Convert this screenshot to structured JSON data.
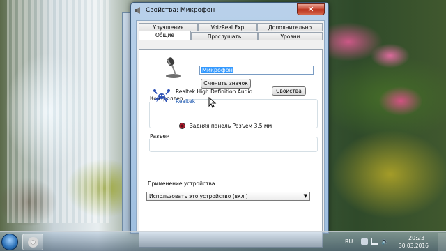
{
  "window": {
    "title": "Свойства: Микрофон",
    "close_glyph": "✕"
  },
  "tabs": {
    "row_back": [
      "Улучшения",
      "VoizReal Exp",
      "Дополнительно"
    ],
    "row_front": [
      "Общие",
      "Прослушать",
      "Уровни"
    ],
    "active": "Общие"
  },
  "general": {
    "device_name": "Микрофон",
    "change_icon_button": "Сменить значок",
    "controller_group": "Контроллер",
    "controller_name": "Realtek High Definition Audio",
    "controller_vendor": "Realtek",
    "properties_button": "Свойства",
    "jack_group": "Разъем",
    "jack_text": "Задняя панель Разъем 3,5 мм",
    "usage_label": "Применение устройства:",
    "usage_value": "Использовать это устройство (вкл.)"
  },
  "taskbar": {
    "language": "RU",
    "time": "20:23",
    "date": "30.03.2016"
  },
  "icons": [
    "microphone-icon",
    "realtek-crab-icon",
    "red-jack-icon",
    "windows-start-icon",
    "media-player-icon",
    "network-icon",
    "volume-icon",
    "flag-icon",
    "mouse-cursor-icon"
  ],
  "colors": {
    "selection": "#3399ff",
    "link_vendor": "#1a56b0",
    "close_button": "#c7452f"
  }
}
